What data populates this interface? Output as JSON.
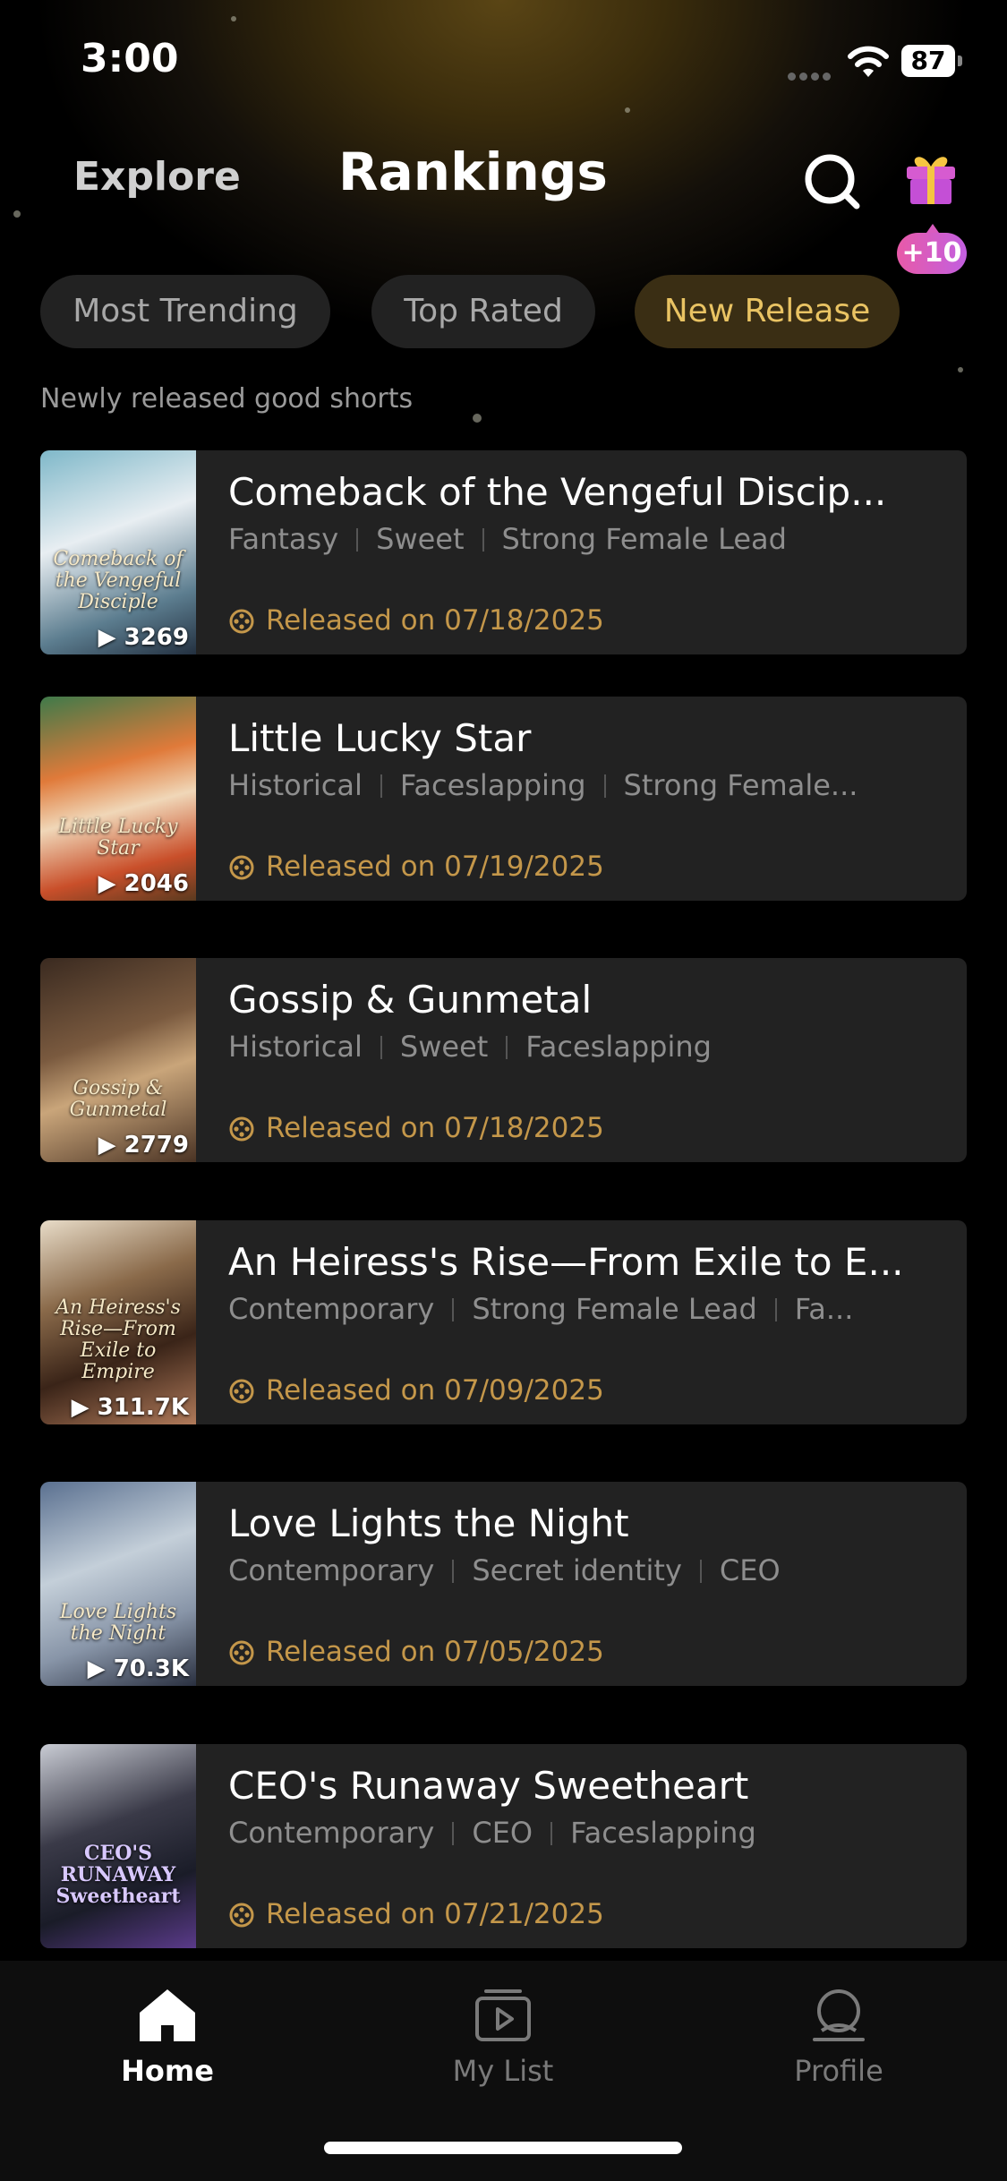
{
  "status_bar": {
    "time": "3:00",
    "battery": "87"
  },
  "header": {
    "explore": "Explore",
    "title": "Rankings",
    "gift_badge": "+10"
  },
  "tabs": [
    {
      "label": "Most Trending",
      "active": false
    },
    {
      "label": "Top Rated",
      "active": false
    },
    {
      "label": "New Release",
      "active": true
    }
  ],
  "subtitle": "Newly released good shorts",
  "shows": [
    {
      "title": "Comeback of the Vengeful Discip...",
      "tags": [
        "Fantasy",
        "Sweet",
        "Strong Female Lead"
      ],
      "release": "Released on 07/18/2025",
      "plays": "3269",
      "poster_text": "Comeback of the Vengeful Disciple"
    },
    {
      "title": "Little Lucky Star",
      "tags": [
        "Historical",
        "Faceslapping",
        "Strong Female..."
      ],
      "release": "Released on 07/19/2025",
      "plays": "2046",
      "poster_text": "Little Lucky Star"
    },
    {
      "title": "Gossip & Gunmetal",
      "tags": [
        "Historical",
        "Sweet",
        "Faceslapping"
      ],
      "release": "Released on 07/18/2025",
      "plays": "2779",
      "poster_text": "Gossip & Gunmetal"
    },
    {
      "title": "An Heiress's Rise—From Exile to E...",
      "tags": [
        "Contemporary",
        "Strong Female Lead",
        "Fa..."
      ],
      "release": "Released on 07/09/2025",
      "plays": "311.7K",
      "poster_text": "An Heiress's Rise—From Exile to Empire"
    },
    {
      "title": "Love Lights the Night",
      "tags": [
        "Contemporary",
        "Secret identity",
        "CEO"
      ],
      "release": "Released on 07/05/2025",
      "plays": "70.3K",
      "poster_text": "Love Lights the Night"
    },
    {
      "title": "CEO's Runaway Sweetheart",
      "tags": [
        "Contemporary",
        "CEO",
        "Faceslapping"
      ],
      "release": "Released on 07/21/2025",
      "plays": "",
      "poster_text": "CEO'S RUNAWAY Sweetheart"
    }
  ],
  "nav": [
    {
      "label": "Home",
      "active": true
    },
    {
      "label": "My List",
      "active": false
    },
    {
      "label": "Profile",
      "active": false
    }
  ],
  "colors": {
    "accent": "#c4974a",
    "active_tab_text": "#e9c363",
    "card_bg": "#222222"
  }
}
